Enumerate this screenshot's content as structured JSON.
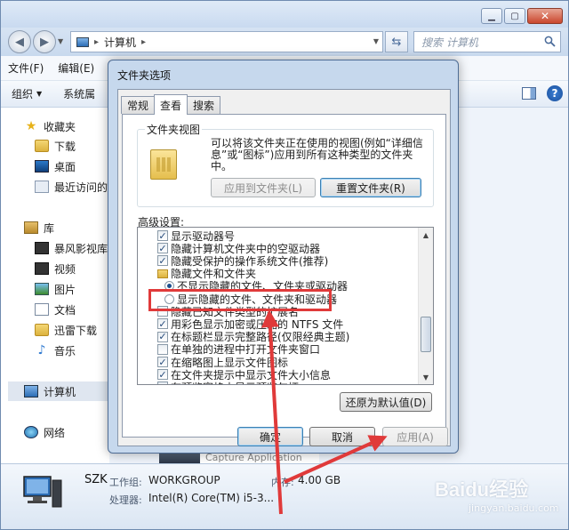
{
  "explorer": {
    "address_path": "计算机",
    "search_placeholder": "搜索 计算机",
    "menu": [
      "文件(F)",
      "编辑(E)"
    ],
    "toolbar": {
      "organize": "组织",
      "system": "系统属"
    },
    "sidebar": {
      "favorites": "收藏夹",
      "downloads": "下载",
      "desktop": "桌面",
      "recent": "最近访问的位",
      "libraries": "库",
      "baofeng": "暴风影视库",
      "videos": "视频",
      "pictures": "图片",
      "documents": "文档",
      "xunlei": "迅雷下载",
      "music": "音乐",
      "computer": "计算机",
      "network": "网络"
    },
    "details": {
      "name": "SZK",
      "workgroup_label": "工作组:",
      "workgroup_value": "WORKGROUP",
      "memory_label": "内存:",
      "memory_value": "4.00 GB",
      "cpu_label": "处理器:",
      "cpu_value": "Intel(R) Core(TM) i5-3..."
    },
    "behind_text": "Capture Application"
  },
  "dialog": {
    "title": "文件夹选项",
    "tabs": [
      "常规",
      "查看",
      "搜索"
    ],
    "folder_view": {
      "legend": "文件夹视图",
      "description": "可以将该文件夹正在使用的视图(例如“详细信息”或“图标”)应用到所有这种类型的文件夹中。",
      "apply_button": "应用到文件夹(L)",
      "reset_button": "重置文件夹(R)"
    },
    "advanced_label": "高级设置:",
    "settings": [
      {
        "kind": "checkbox",
        "checked": true,
        "indent": 1,
        "label": "显示驱动器号"
      },
      {
        "kind": "checkbox",
        "checked": true,
        "indent": 1,
        "label": "隐藏计算机文件夹中的空驱动器"
      },
      {
        "kind": "checkbox",
        "checked": true,
        "indent": 1,
        "label": "隐藏受保护的操作系统文件(推荐)"
      },
      {
        "kind": "folder",
        "indent": 1,
        "label": "隐藏文件和文件夹"
      },
      {
        "kind": "radio",
        "checked": true,
        "indent": 2,
        "label": "不显示隐藏的文件、文件夹或驱动器"
      },
      {
        "kind": "radio",
        "checked": false,
        "indent": 2,
        "label": "显示隐藏的文件、文件夹和驱动器"
      },
      {
        "kind": "checkbox",
        "checked": false,
        "indent": 1,
        "label": "隐藏已知文件类型的扩展名"
      },
      {
        "kind": "checkbox",
        "checked": true,
        "indent": 1,
        "label": "用彩色显示加密或压缩的 NTFS 文件"
      },
      {
        "kind": "checkbox",
        "checked": true,
        "indent": 1,
        "label": "在标题栏显示完整路径(仅限经典主题)"
      },
      {
        "kind": "checkbox",
        "checked": false,
        "indent": 1,
        "label": "在单独的进程中打开文件夹窗口"
      },
      {
        "kind": "checkbox",
        "checked": true,
        "indent": 1,
        "label": "在缩略图上显示文件图标"
      },
      {
        "kind": "checkbox",
        "checked": true,
        "indent": 1,
        "label": "在文件夹提示中显示文件大小信息"
      },
      {
        "kind": "checkbox",
        "checked": true,
        "indent": 1,
        "label": "在预览窗格中显示预览句柄"
      }
    ],
    "restore_button": "还原为默认值(D)",
    "ok_button": "确定",
    "cancel_button": "取消",
    "apply_button": "应用(A)"
  },
  "watermark": {
    "brand": "Baidu经验",
    "domain": "jingyan.baidu.com"
  },
  "annotation_color": "#e03a3a"
}
